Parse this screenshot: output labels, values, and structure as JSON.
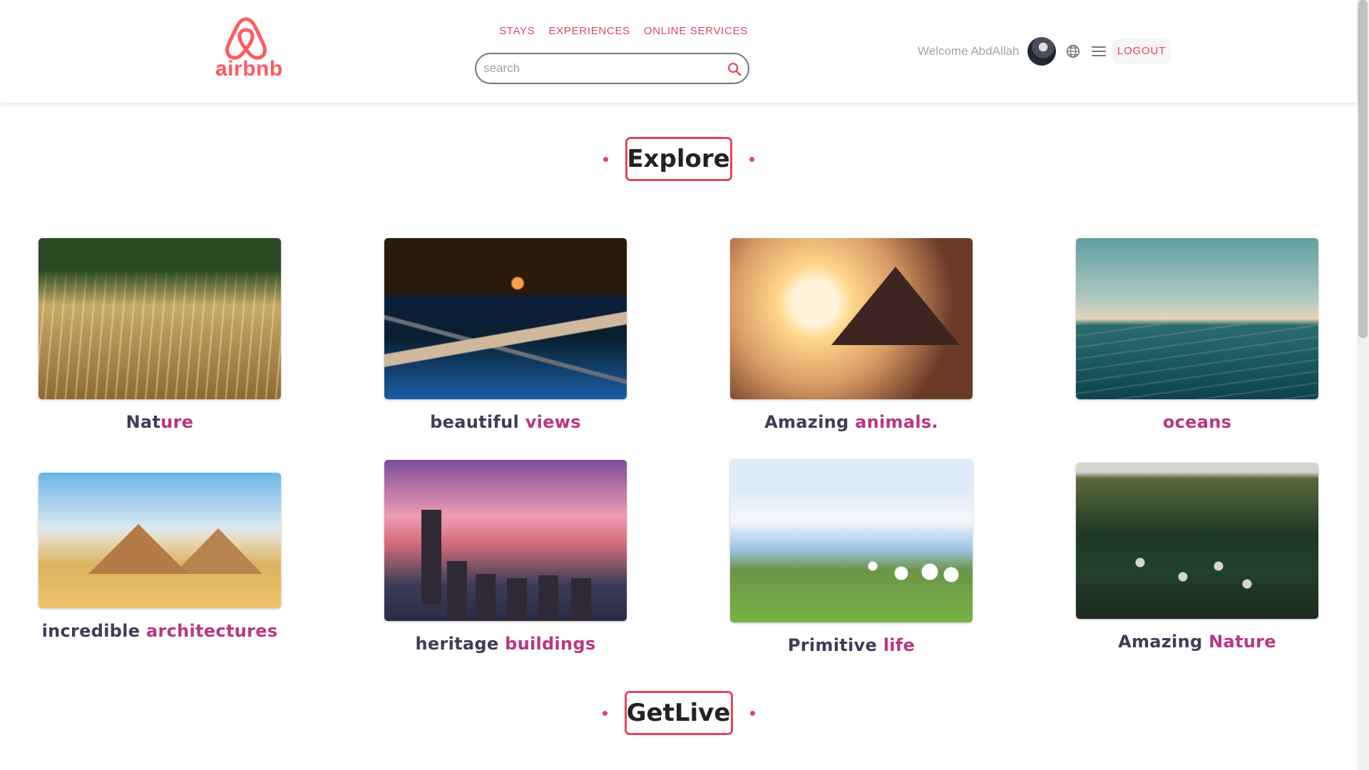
{
  "header": {
    "logo_text": "airbnb",
    "nav": [
      "STAYS",
      "EXPERIENCES",
      "ONLINE SERVICES"
    ],
    "search": {
      "placeholder": "search",
      "value": ""
    },
    "welcome": "Welcome AbdAllah",
    "logout": "LOGOUT",
    "icons": {
      "search": "search-icon",
      "globe": "globe-icon",
      "menu": "hamburger-menu-icon",
      "avatar": "user-avatar"
    }
  },
  "main": {
    "sections": [
      {
        "title": "Explore"
      },
      {
        "title": "GetLive"
      }
    ],
    "cards": [
      {
        "caption": [
          "Nat",
          "ure"
        ]
      },
      {
        "caption": [
          "beautiful ",
          "views"
        ]
      },
      {
        "caption": [
          "Amazing ",
          "animals."
        ]
      },
      {
        "caption": [
          "",
          "oceans"
        ]
      },
      {
        "caption": [
          "incredible ",
          "architectures"
        ]
      },
      {
        "caption": [
          "heritage ",
          "buildings"
        ]
      },
      {
        "caption": [
          "Primitive ",
          "life"
        ]
      },
      {
        "caption": [
          "Amazing ",
          "Nature"
        ]
      }
    ]
  },
  "colors": {
    "brand": "#ff5a5f",
    "accent": "#e2455f",
    "caption": "#3f3d56",
    "highlight": "#b93583"
  }
}
